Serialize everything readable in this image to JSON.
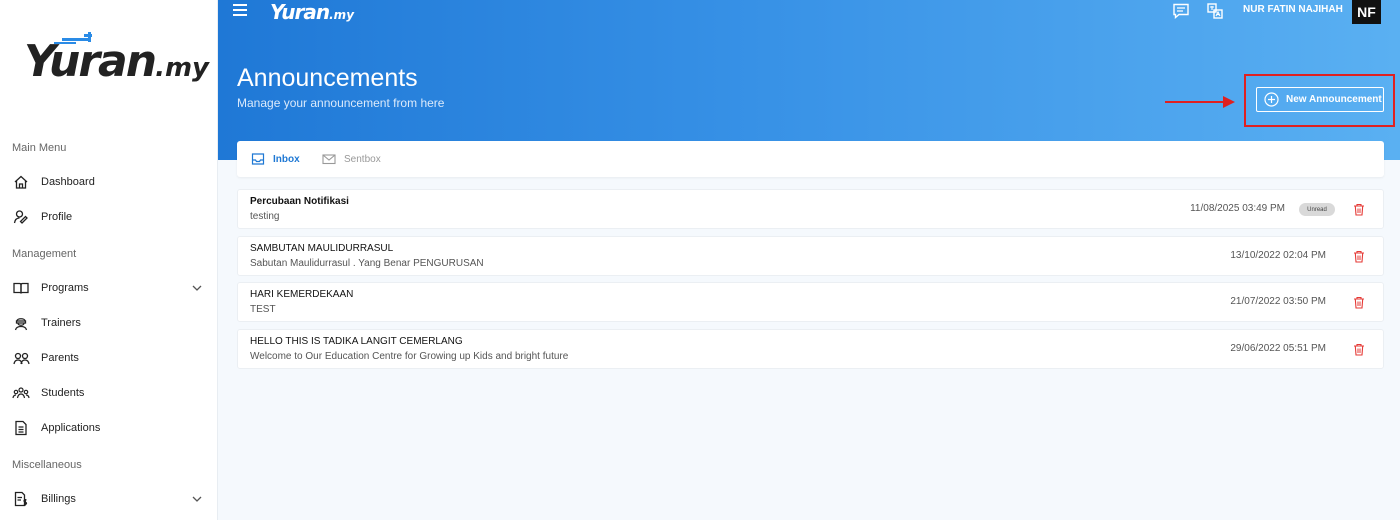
{
  "app": {
    "logo_main": "Yuran",
    "logo_tld": ".my"
  },
  "sidebar": {
    "sections": [
      {
        "label": "Main Menu"
      },
      {
        "label": "Management"
      },
      {
        "label": "Miscellaneous"
      }
    ],
    "items": [
      {
        "label": "Dashboard",
        "icon": "home-icon"
      },
      {
        "label": "Profile",
        "icon": "user-edit-icon"
      },
      {
        "label": "Programs",
        "icon": "book-icon",
        "expandable": true
      },
      {
        "label": "Trainers",
        "icon": "trainer-icon"
      },
      {
        "label": "Parents",
        "icon": "users-icon"
      },
      {
        "label": "Students",
        "icon": "group-icon"
      },
      {
        "label": "Applications",
        "icon": "document-icon"
      },
      {
        "label": "Billings",
        "icon": "billing-icon",
        "expandable": true
      }
    ]
  },
  "header": {
    "user_name": "NUR FATIN NAJIHAH",
    "avatar_initials": "NF",
    "page_title": "Announcements",
    "page_subtitle": "Manage your announcement from here",
    "new_button_label": "New Announcement"
  },
  "tabs": [
    {
      "label": "Inbox",
      "active": true,
      "icon": "inbox-icon"
    },
    {
      "label": "Sentbox",
      "active": false,
      "icon": "mail-icon"
    }
  ],
  "announcements": [
    {
      "title": "Percubaan Notifikasi",
      "body": "testing",
      "date": "11/08/2025 03:49 PM",
      "badge": "Unread"
    },
    {
      "title": "SAMBUTAN MAULIDURRASUL",
      "body": "Sabutan Maulidurrasul . Yang Benar PENGURUSAN",
      "date": "13/10/2022 02:04 PM"
    },
    {
      "title": "HARI KEMERDEKAAN",
      "body": "TEST",
      "date": "21/07/2022 03:50 PM"
    },
    {
      "title": "HELLO THIS IS TADIKA LANGIT CEMERLANG",
      "body": "Welcome to Our Education Centre for Growing up Kids and bright future",
      "date": "29/06/2022 05:51 PM"
    }
  ],
  "colors": {
    "primary": "#1e78d4",
    "header_start": "#1f78d6",
    "header_end": "#5ab0f2",
    "delete": "#e53935",
    "highlight": "#e02020"
  }
}
